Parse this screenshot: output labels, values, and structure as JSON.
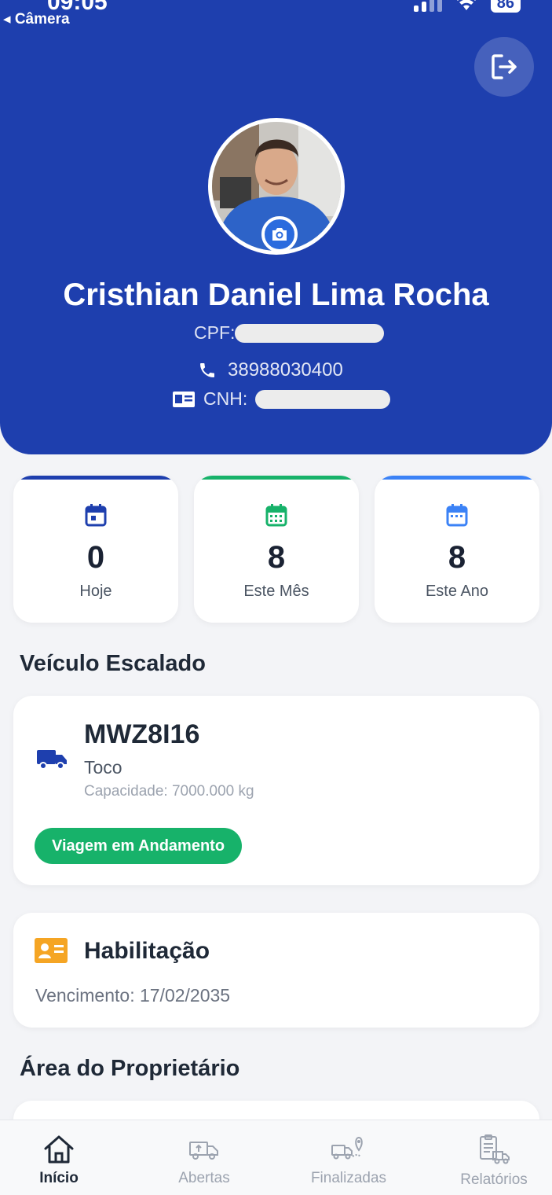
{
  "status_bar": {
    "time": "09:05",
    "battery": "86",
    "back_label": "◂ Câmera"
  },
  "header": {
    "name": "Cristhian Daniel Lima Rocha",
    "cpf_label": "CPF:",
    "phone": "38988030400",
    "cnh_label": "CNH:"
  },
  "stats": [
    {
      "value": "0",
      "label": "Hoje",
      "color": "#1e3fae"
    },
    {
      "value": "8",
      "label": "Este Mês",
      "color": "#17b26a"
    },
    {
      "value": "8",
      "label": "Este Ano",
      "color": "#3b82f6"
    }
  ],
  "vehicle_section": {
    "title": "Veículo Escalado",
    "plate": "MWZ8I16",
    "type": "Toco",
    "capacity": "Capacidade: 7000.000 kg",
    "status": "Viagem em Andamento"
  },
  "license": {
    "title": "Habilitação",
    "expiry": "Vencimento: 17/02/2035"
  },
  "owner_section": {
    "title": "Área do Proprietário"
  },
  "nav": {
    "home": "Início",
    "open": "Abertas",
    "finished": "Finalizadas",
    "reports": "Relatórios"
  },
  "colors": {
    "primary": "#1e3fae",
    "success": "#17b26a",
    "accent_blue": "#3b82f6",
    "license_orange": "#f5a524"
  }
}
